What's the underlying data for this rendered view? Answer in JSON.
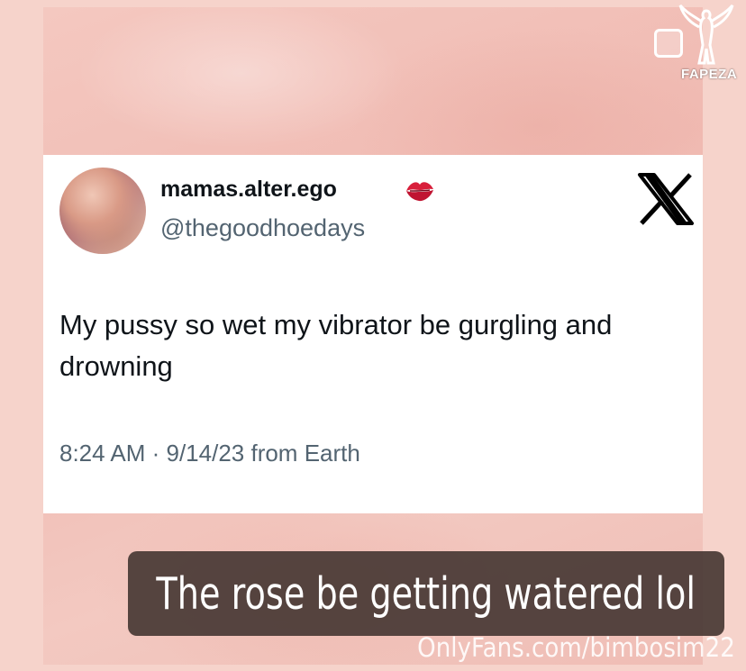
{
  "post": {
    "display_name": "mamas.alter.ego",
    "handle": "@thegoodhoedays",
    "text": "My pussy so wet my vibrator be gurgling and drowning",
    "meta": "8:24 AM · 9/14/23 from Earth",
    "name_emoji": "kiss-mark-icon",
    "platform_logo": "x-logo-icon"
  },
  "caption": "The rose be getting watered lol",
  "watermarks": {
    "bottom": "OnlyFans.com/bimbosim22",
    "top": "FAPEZA"
  },
  "colors": {
    "background": "#f6d3cb",
    "card": "#ffffff",
    "text_primary": "#0f1419",
    "text_secondary": "#536471",
    "caption_bg": "#48383480",
    "emoji": "#d81e3a"
  }
}
